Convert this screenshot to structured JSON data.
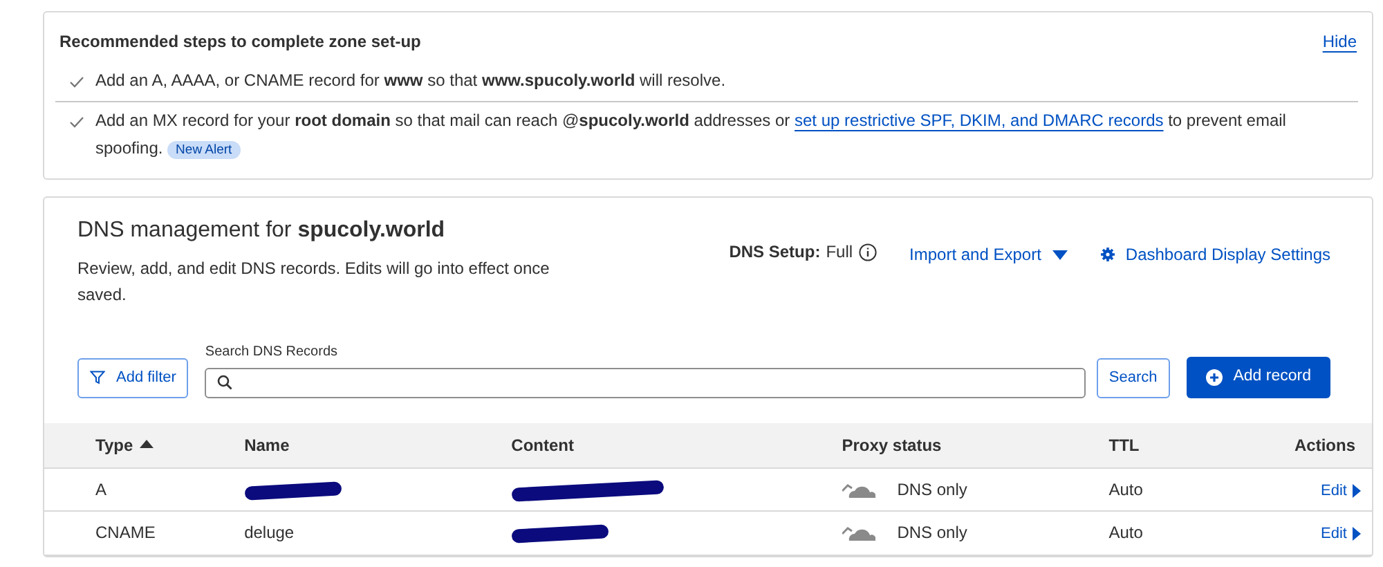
{
  "setup_card": {
    "title": "Recommended steps to complete zone set-up",
    "hide_link": "Hide",
    "steps": [
      {
        "done": true,
        "text": "Add an A, AAAA, or CNAME record for **www** so that **www.spucoly.world** will resolve."
      },
      {
        "done": true,
        "text": "Add an MX record for your **root domain** so that mail can reach @**spucoly.world** addresses or",
        "link": "set up restrictive SPF, DKIM, and DMARC records",
        "after": "to prevent email spoofing.",
        "badge": "New Alert"
      }
    ]
  },
  "dns_card": {
    "title": "DNS management for",
    "domain": "spucoly.world",
    "description": "Review, add, and edit DNS records. Edits will go into effect once saved.",
    "setup_label": "DNS Setup:",
    "setup_value": "Full",
    "import_export": "Import and Export",
    "display_settings": "Dashboard Display Settings",
    "filter_button": "Add filter",
    "search_label": "Search DNS Records",
    "search_button": "Search",
    "add_button": "Add record",
    "table": {
      "columns": [
        {
          "label": "Type",
          "sorted": true
        },
        {
          "label": "Name",
          "sorted": false
        },
        {
          "label": "Content",
          "sorted": false
        },
        {
          "label": "Proxy status",
          "sorted": false
        },
        {
          "label": "TTL",
          "sorted": false
        },
        {
          "label": "Actions",
          "sorted": false
        }
      ],
      "rows": [
        {
          "type": "A",
          "name_redacted": true,
          "content_redacted": true,
          "proxy": "DNS only",
          "ttl": "Auto",
          "action": "Edit"
        },
        {
          "type": "CNAME",
          "name": "deluge",
          "name_redacted": false,
          "content_redacted": true,
          "proxy": "DNS only",
          "ttl": "Auto",
          "action": "Edit"
        }
      ]
    }
  }
}
